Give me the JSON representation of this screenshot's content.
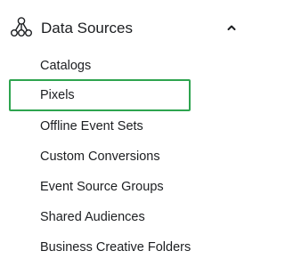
{
  "section": {
    "title": "Data Sources",
    "icon": "data-sources-network-icon",
    "toggle_icon": "chevron-up-icon",
    "expanded": true
  },
  "items": [
    {
      "label": "Catalogs",
      "selected": false
    },
    {
      "label": "Pixels",
      "selected": true
    },
    {
      "label": "Offline Event Sets",
      "selected": false
    },
    {
      "label": "Custom Conversions",
      "selected": false
    },
    {
      "label": "Event Source Groups",
      "selected": false
    },
    {
      "label": "Shared Audiences",
      "selected": false
    },
    {
      "label": "Business Creative Folders",
      "selected": false
    }
  ],
  "colors": {
    "text": "#1c1e21",
    "highlight_border": "#2ea44f"
  }
}
